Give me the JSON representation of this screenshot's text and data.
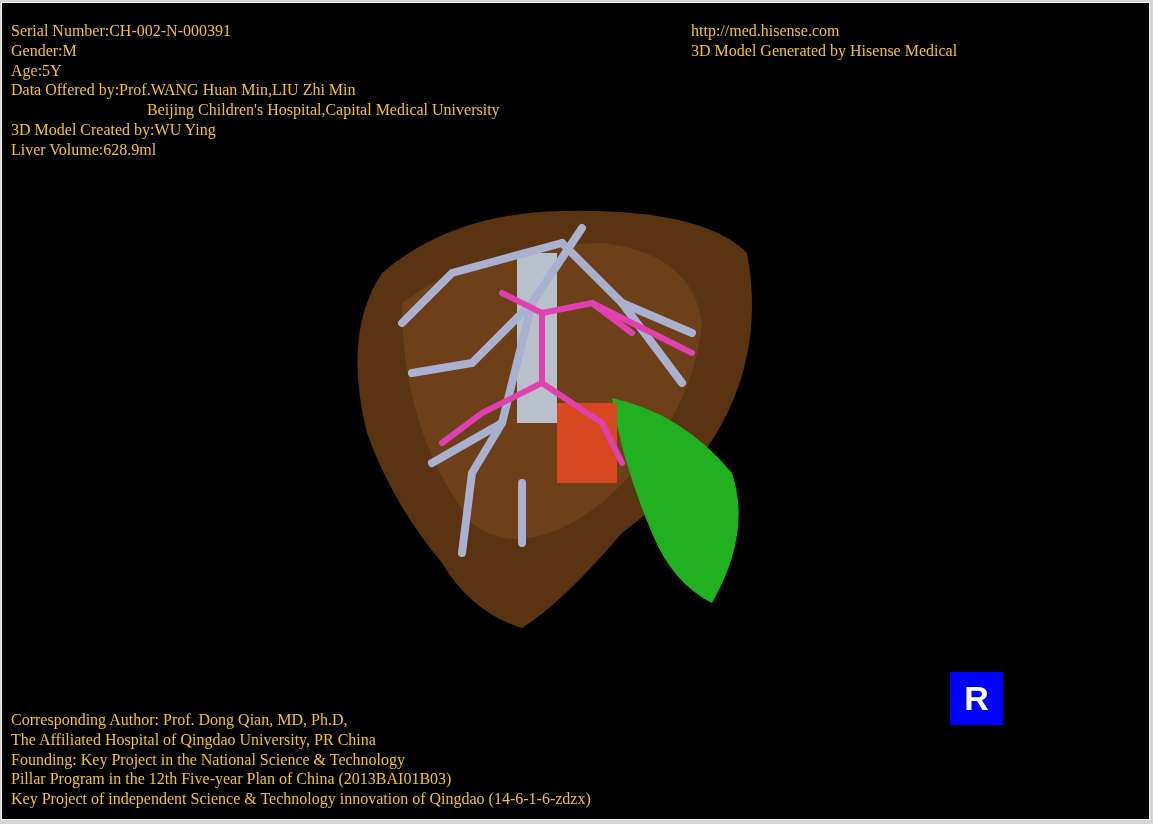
{
  "info_lines": [
    {
      "text": "Serial Number:CH-002-N-000391",
      "indent": false
    },
    {
      "text": "Gender:M",
      "indent": false
    },
    {
      "text": "Age:5Y",
      "indent": false
    },
    {
      "text": "Data Offered by:Prof.WANG Huan Min,LIU Zhi Min",
      "indent": false
    },
    {
      "text": "Beijing Children's Hospital,Capital Medical University",
      "indent": true
    },
    {
      "text": "3D Model Created by:WU Ying",
      "indent": false
    },
    {
      "text": "Liver Volume:628.9ml",
      "indent": false
    }
  ],
  "credit_lines": [
    "http://med.hisense.com",
    "3D Model Generated by Hisense Medical"
  ],
  "orientation_marker": "R",
  "footer_lines": [
    "Corresponding Author: Prof. Dong Qian, MD, Ph.D,",
    "The Affiliated Hospital of Qingdao University, PR China",
    "Founding: Key Project in the National Science & Technology",
    "Pillar Program in the 12th Five-year Plan of China (2013BAI01B03)",
    "Key Project of independent Science & Technology innovation of Qingdao (14-6-1-6-zdzx)"
  ]
}
